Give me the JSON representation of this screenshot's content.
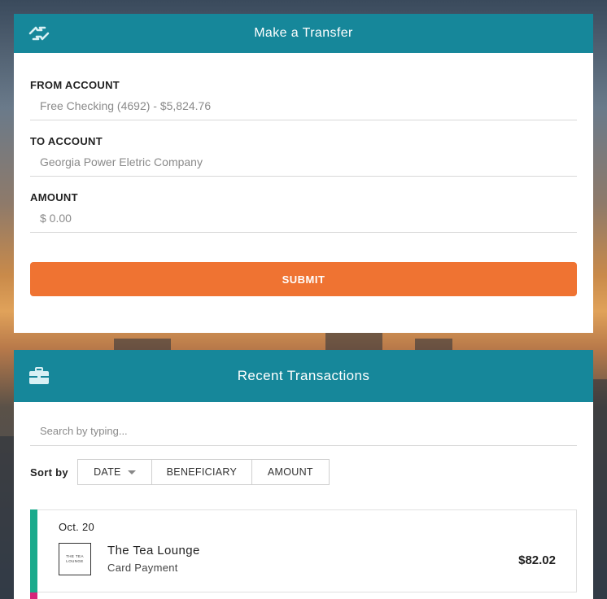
{
  "transfer": {
    "title": "Make a Transfer",
    "icon": "transfer-arrows-icon",
    "from_label": "FROM ACCOUNT",
    "from_value": "Free Checking (4692) - $5,824.76",
    "to_label": "TO ACCOUNT",
    "to_value": "Georgia Power Eletric Company",
    "amount_label": "AMOUNT",
    "amount_value": "$ 0.00",
    "submit_label": "SUBMIT"
  },
  "transactions": {
    "title": "Recent Transactions",
    "icon": "briefcase-icon",
    "search_placeholder": "Search by typing...",
    "sort_label": "Sort by",
    "sort_options": [
      "DATE",
      "BENEFICIARY",
      "AMOUNT"
    ],
    "items": [
      {
        "date": "Oct. 20",
        "logo_text": "THE TEA LOUNGE",
        "name": "The Tea Lounge",
        "type": "Card Payment",
        "amount": "$82.02",
        "accent_color": "#1aaa8c"
      }
    ],
    "next_accent_color": "#d6257a"
  },
  "colors": {
    "header": "#16879a",
    "submit": "#ef7332"
  }
}
